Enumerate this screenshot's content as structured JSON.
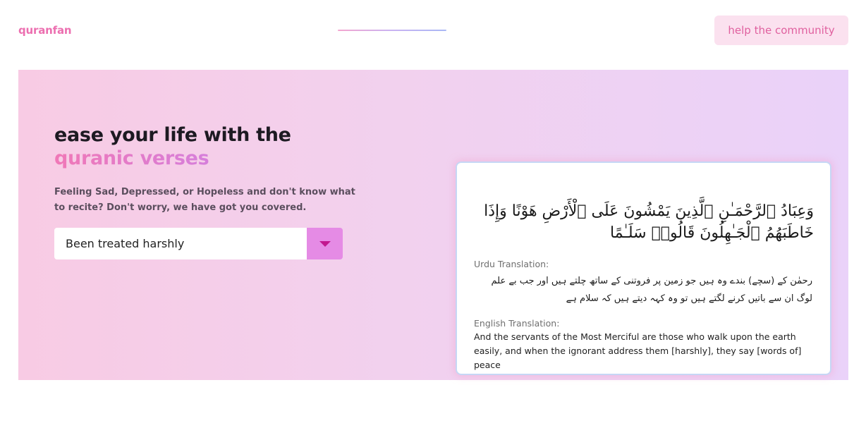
{
  "header": {
    "logo": "quranfan",
    "help_label": "help the community"
  },
  "hero": {
    "headline_line1": "ease your life with the",
    "headline_line2": "quranic verses",
    "subtitle": "Feeling Sad, Depressed, or Hopeless and don't know what to recite? Don't worry, we have got you covered.",
    "select": {
      "value": "Been treated harshly"
    }
  },
  "verse": {
    "arabic": "وَعِبَادُ ٱلرَّحْمَـٰنِ ٱلَّذِينَ يَمْشُونَ عَلَى ٱلْأَرْضِ هَوْنًا وَإِذَا خَاطَبَهُمُ ٱلْجَـٰهِلُونَ قَالُوا۟ سَلَـٰمًا",
    "urdu_label": "Urdu Translation:",
    "urdu": "رحمٰن کے (سچے) بندے وہ ہیں جو زمین پر فروتنی کے ساتھ چلتے ہیں اور جب بے علم لوگ ان سے باتیں کرنے لگتے ہیں تو وہ کہہ دیتے ہیں کہ سلام ہے",
    "english_label": "English Translation:",
    "english": "And the servants of the Most Merciful are those who walk upon the earth easily, and when the ignorant address them [harshly], they say [words of] peace"
  },
  "colors": {
    "brand_pink": "#ec6fb0",
    "accent_violet": "#c882ee",
    "select_button": "#e58be5",
    "help_bg": "#fbe1ef"
  }
}
